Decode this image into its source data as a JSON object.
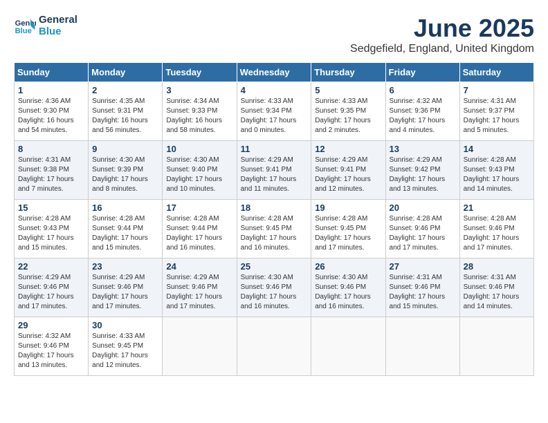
{
  "logo": {
    "line1": "General",
    "line2": "Blue"
  },
  "title": "June 2025",
  "location": "Sedgefield, England, United Kingdom",
  "weekdays": [
    "Sunday",
    "Monday",
    "Tuesday",
    "Wednesday",
    "Thursday",
    "Friday",
    "Saturday"
  ],
  "weeks": [
    [
      {
        "day": "1",
        "sunrise": "4:36 AM",
        "sunset": "9:30 PM",
        "daylight": "16 hours and 54 minutes."
      },
      {
        "day": "2",
        "sunrise": "4:35 AM",
        "sunset": "9:31 PM",
        "daylight": "16 hours and 56 minutes."
      },
      {
        "day": "3",
        "sunrise": "4:34 AM",
        "sunset": "9:33 PM",
        "daylight": "16 hours and 58 minutes."
      },
      {
        "day": "4",
        "sunrise": "4:33 AM",
        "sunset": "9:34 PM",
        "daylight": "17 hours and 0 minutes."
      },
      {
        "day": "5",
        "sunrise": "4:33 AM",
        "sunset": "9:35 PM",
        "daylight": "17 hours and 2 minutes."
      },
      {
        "day": "6",
        "sunrise": "4:32 AM",
        "sunset": "9:36 PM",
        "daylight": "17 hours and 4 minutes."
      },
      {
        "day": "7",
        "sunrise": "4:31 AM",
        "sunset": "9:37 PM",
        "daylight": "17 hours and 5 minutes."
      }
    ],
    [
      {
        "day": "8",
        "sunrise": "4:31 AM",
        "sunset": "9:38 PM",
        "daylight": "17 hours and 7 minutes."
      },
      {
        "day": "9",
        "sunrise": "4:30 AM",
        "sunset": "9:39 PM",
        "daylight": "17 hours and 8 minutes."
      },
      {
        "day": "10",
        "sunrise": "4:30 AM",
        "sunset": "9:40 PM",
        "daylight": "17 hours and 10 minutes."
      },
      {
        "day": "11",
        "sunrise": "4:29 AM",
        "sunset": "9:41 PM",
        "daylight": "17 hours and 11 minutes."
      },
      {
        "day": "12",
        "sunrise": "4:29 AM",
        "sunset": "9:41 PM",
        "daylight": "17 hours and 12 minutes."
      },
      {
        "day": "13",
        "sunrise": "4:29 AM",
        "sunset": "9:42 PM",
        "daylight": "17 hours and 13 minutes."
      },
      {
        "day": "14",
        "sunrise": "4:28 AM",
        "sunset": "9:43 PM",
        "daylight": "17 hours and 14 minutes."
      }
    ],
    [
      {
        "day": "15",
        "sunrise": "4:28 AM",
        "sunset": "9:43 PM",
        "daylight": "17 hours and 15 minutes."
      },
      {
        "day": "16",
        "sunrise": "4:28 AM",
        "sunset": "9:44 PM",
        "daylight": "17 hours and 15 minutes."
      },
      {
        "day": "17",
        "sunrise": "4:28 AM",
        "sunset": "9:44 PM",
        "daylight": "17 hours and 16 minutes."
      },
      {
        "day": "18",
        "sunrise": "4:28 AM",
        "sunset": "9:45 PM",
        "daylight": "17 hours and 16 minutes."
      },
      {
        "day": "19",
        "sunrise": "4:28 AM",
        "sunset": "9:45 PM",
        "daylight": "17 hours and 17 minutes."
      },
      {
        "day": "20",
        "sunrise": "4:28 AM",
        "sunset": "9:46 PM",
        "daylight": "17 hours and 17 minutes."
      },
      {
        "day": "21",
        "sunrise": "4:28 AM",
        "sunset": "9:46 PM",
        "daylight": "17 hours and 17 minutes."
      }
    ],
    [
      {
        "day": "22",
        "sunrise": "4:29 AM",
        "sunset": "9:46 PM",
        "daylight": "17 hours and 17 minutes."
      },
      {
        "day": "23",
        "sunrise": "4:29 AM",
        "sunset": "9:46 PM",
        "daylight": "17 hours and 17 minutes."
      },
      {
        "day": "24",
        "sunrise": "4:29 AM",
        "sunset": "9:46 PM",
        "daylight": "17 hours and 17 minutes."
      },
      {
        "day": "25",
        "sunrise": "4:30 AM",
        "sunset": "9:46 PM",
        "daylight": "17 hours and 16 minutes."
      },
      {
        "day": "26",
        "sunrise": "4:30 AM",
        "sunset": "9:46 PM",
        "daylight": "17 hours and 16 minutes."
      },
      {
        "day": "27",
        "sunrise": "4:31 AM",
        "sunset": "9:46 PM",
        "daylight": "17 hours and 15 minutes."
      },
      {
        "day": "28",
        "sunrise": "4:31 AM",
        "sunset": "9:46 PM",
        "daylight": "17 hours and 14 minutes."
      }
    ],
    [
      {
        "day": "29",
        "sunrise": "4:32 AM",
        "sunset": "9:46 PM",
        "daylight": "17 hours and 13 minutes."
      },
      {
        "day": "30",
        "sunrise": "4:33 AM",
        "sunset": "9:45 PM",
        "daylight": "17 hours and 12 minutes."
      },
      null,
      null,
      null,
      null,
      null
    ]
  ]
}
